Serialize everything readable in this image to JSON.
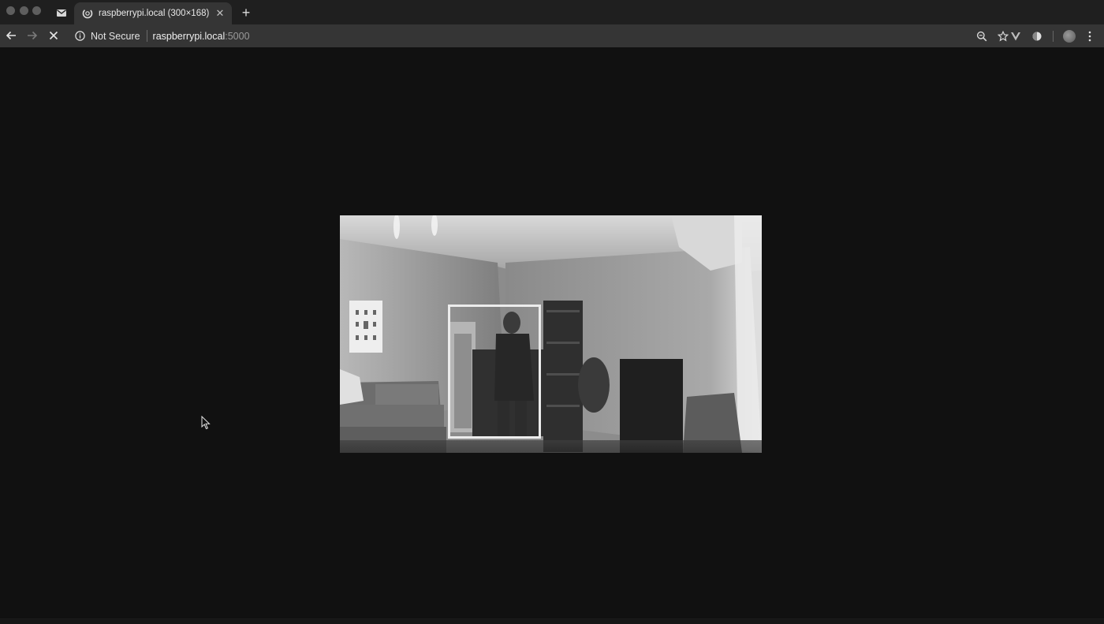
{
  "browser": {
    "tab": {
      "title": "raspberrypi.local (300×168)",
      "loading": true
    },
    "toolbar": {
      "security_label": "Not Secure",
      "url_host": "raspberrypi.local",
      "url_port": ":5000"
    }
  },
  "page": {
    "background_color": "#111111",
    "stream": {
      "description_icon": "camera-frame",
      "detection_box_color": "#ececec"
    }
  }
}
